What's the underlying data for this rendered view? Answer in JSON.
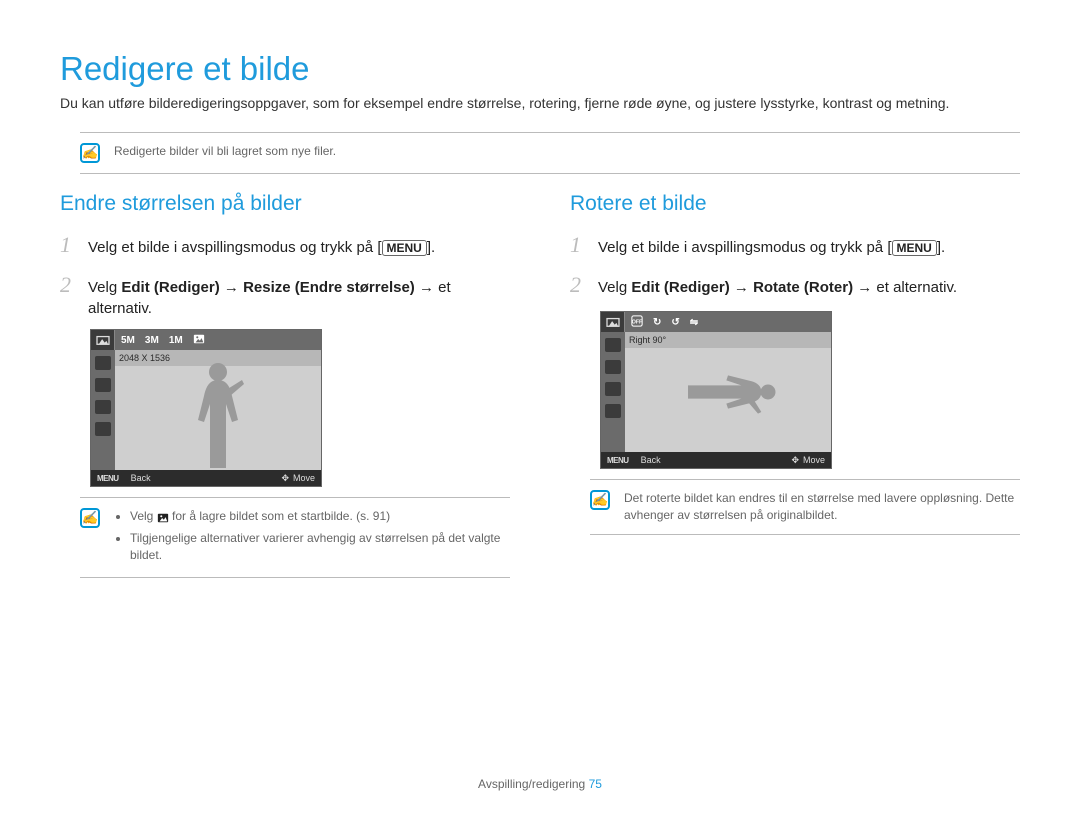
{
  "title": "Redigere et bilde",
  "intro": "Du kan utføre bilderedigeringsoppgaver, som for eksempel endre størrelse, rotering, fjerne røde øyne, og justere lysstyrke, kontrast og metning.",
  "top_note": "Redigerte bilder vil bli lagret som nye filer.",
  "menu_button": "MENU",
  "left": {
    "heading": "Endre størrelsen på bilder",
    "step1": "Velg et bilde i avspillingsmodus og trykk på [",
    "step1_tail": "].",
    "step2_pre": "Velg ",
    "step2_bold1": "Edit (Rediger)",
    "step2_arrow": " → ",
    "step2_bold2": "Resize (Endre størrelse)",
    "step2_tail": " → et alternativ.",
    "screen": {
      "info": "2048 X 1536",
      "top_items": [
        "5M",
        "3M",
        "1M"
      ],
      "back": "Back",
      "move": "Move"
    },
    "note_bullet1_pre": "Velg ",
    "note_bullet1_post": " for å lagre bildet som et startbilde. (s. 91)",
    "note_bullet2": "Tilgjengelige alternativer varierer avhengig av størrelsen på det valgte bildet."
  },
  "right": {
    "heading": "Rotere et bilde",
    "step1": "Velg et bilde i avspillingsmodus og trykk på [",
    "step1_tail": "].",
    "step2_pre": "Velg ",
    "step2_bold1": "Edit (Rediger)",
    "step2_arrow": " → ",
    "step2_bold2": "Rotate (Roter)",
    "step2_tail": " → et alternativ.",
    "screen": {
      "info": "Right 90°",
      "back": "Back",
      "move": "Move"
    },
    "note": "Det roterte bildet kan endres til en størrelse med lavere oppløsning. Dette avhenger av størrelsen på originalbildet."
  },
  "footer_label": "Avspilling/redigering",
  "footer_page": "75"
}
